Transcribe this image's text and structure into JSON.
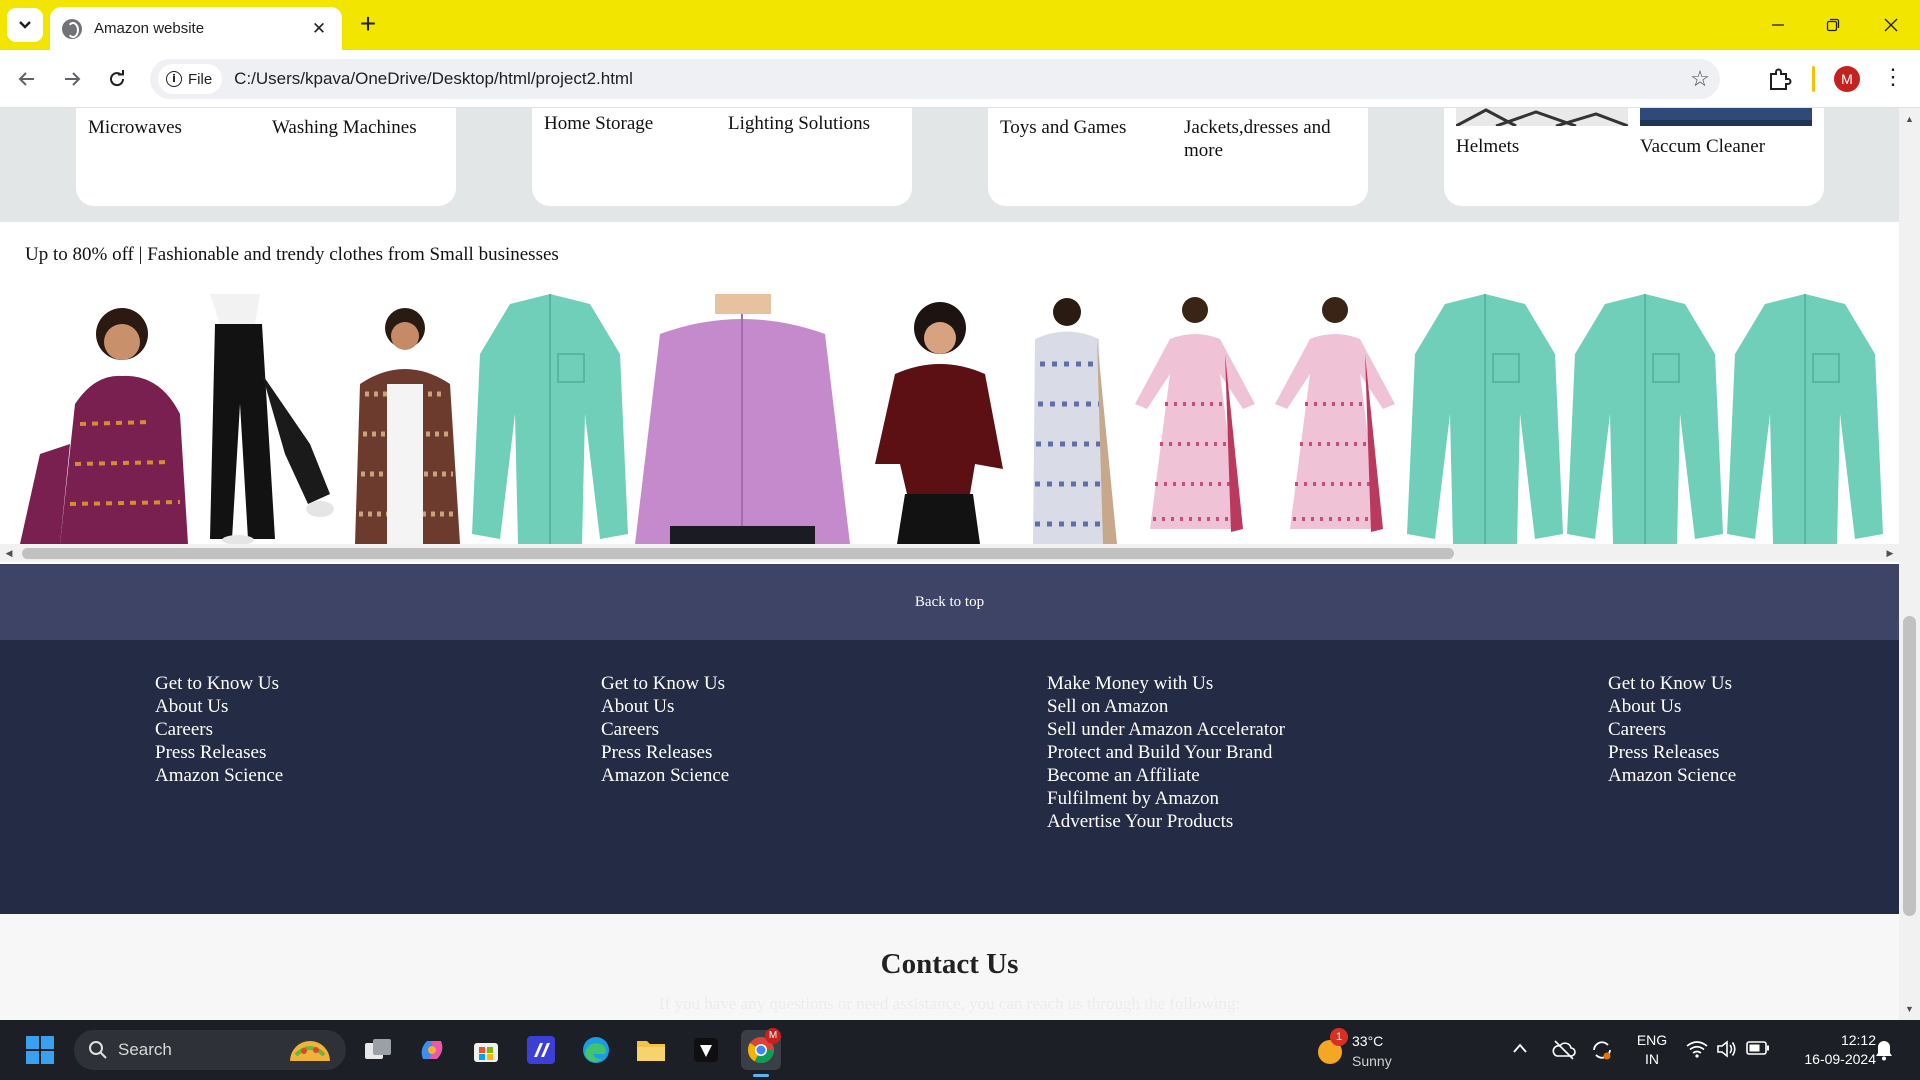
{
  "browser": {
    "tab_title": "Amazon website",
    "file_label": "File",
    "url": "C:/Users/kpava/OneDrive/Desktop/html/project2.html",
    "profile_initial": "M"
  },
  "categories": {
    "card1": [
      "Microwaves",
      "Washing Machines"
    ],
    "card2": [
      "Home Storage",
      "Lighting Solutions"
    ],
    "card3": [
      "Toys and Games",
      "Jackets,dresses and more"
    ],
    "card4": [
      "Helmets",
      "Vaccum Cleaner"
    ]
  },
  "deals": {
    "heading": "Up to 80% off | Fashionable and trendy clothes from Small businesses"
  },
  "back_to_top": "Back to top",
  "footer": {
    "col1": [
      "Get to Know Us",
      "About Us",
      "Careers",
      "Press Releases",
      "Amazon Science"
    ],
    "col2": [
      "Get to Know Us",
      "About Us",
      "Careers",
      "Press Releases",
      "Amazon Science"
    ],
    "col3": [
      "Make Money with Us",
      "Sell on Amazon",
      "Sell under Amazon Accelerator",
      "Protect and Build Your Brand",
      "Become an Affiliate",
      "Fulfilment by Amazon",
      "Advertise Your Products"
    ],
    "col4": [
      "Get to Know Us",
      "About Us",
      "Careers",
      "Press Releases",
      "Amazon Science"
    ]
  },
  "contact": {
    "title": "Contact Us",
    "subtitle": "If you have any questions or need assistance, you can reach us through the following:"
  },
  "taskbar": {
    "search_label": "Search",
    "weather_temp": "33°C",
    "weather_desc": "Sunny",
    "weather_badge": "1",
    "lang_top": "ENG",
    "lang_bottom": "IN",
    "time": "12:12",
    "date": "16-09-2024",
    "chrome_badge": "M"
  },
  "colors": {
    "tabstrip": "#f2e600",
    "back_to_top_bg": "#3d4466",
    "footer_bg": "#242b45",
    "category_band": "#e3e6e6",
    "taskbar_bg": "#1c2026"
  }
}
